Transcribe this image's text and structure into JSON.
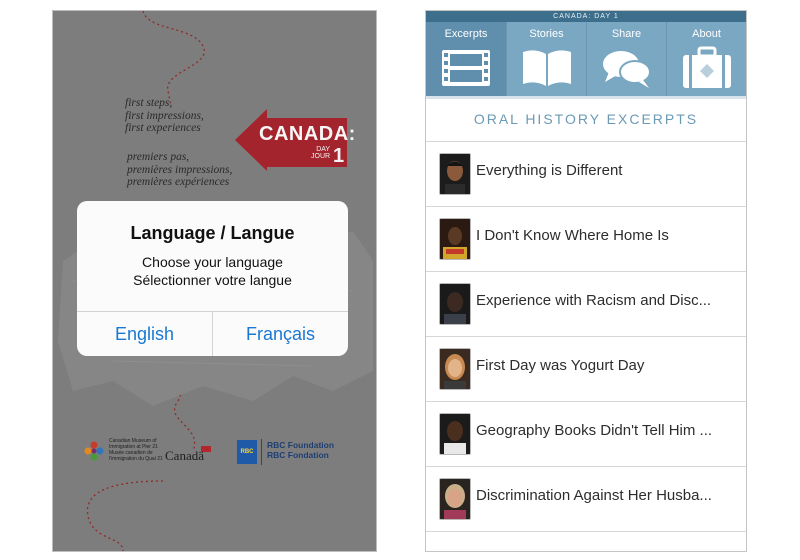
{
  "left_screen": {
    "tagline_en": [
      "first steps,",
      "first impressions,",
      "first experiences"
    ],
    "tagline_fr": [
      "premiers pas,",
      "premières impressions,",
      "premières expériences"
    ],
    "logo": {
      "word": "CANADA:",
      "day_label": "DAY",
      "jour_label": "JOUR",
      "number": "1",
      "color": "#a3242c"
    },
    "dialog": {
      "title": "Language / Langue",
      "message_en": "Choose your language",
      "message_fr": "Sélectionner votre langue",
      "button_en": "English",
      "button_fr": "Français",
      "button_color": "#1a78d2"
    },
    "footer": {
      "museum_lines": [
        "Canadian Museum of",
        "Immigration at Pier 21",
        "Musée canadien de",
        "l'immigration du Quai 21"
      ],
      "canada_wordmark": "Canadä",
      "rbc_badge": "RBC",
      "rbc_lines": [
        "RBC Foundation",
        "RBC Fondation"
      ]
    }
  },
  "right_screen": {
    "status_title": "CANADA: DAY 1",
    "tabs": [
      {
        "label": "Excerpts",
        "icon": "film-icon"
      },
      {
        "label": "Stories",
        "icon": "book-icon"
      },
      {
        "label": "Share",
        "icon": "chat-bubbles-icon"
      },
      {
        "label": "About",
        "icon": "suitcase-icon"
      }
    ],
    "section_title": "ORAL HISTORY EXCERPTS",
    "items": [
      {
        "title": "Everything is Different"
      },
      {
        "title": "I Don't Know Where Home Is"
      },
      {
        "title": "Experience with Racism and Disc..."
      },
      {
        "title": "First Day was Yogurt Day"
      },
      {
        "title": "Geography Books Didn't Tell Him ..."
      },
      {
        "title": "Discrimination Against Her Husba..."
      }
    ],
    "accent_color": "#7aa7c2"
  }
}
